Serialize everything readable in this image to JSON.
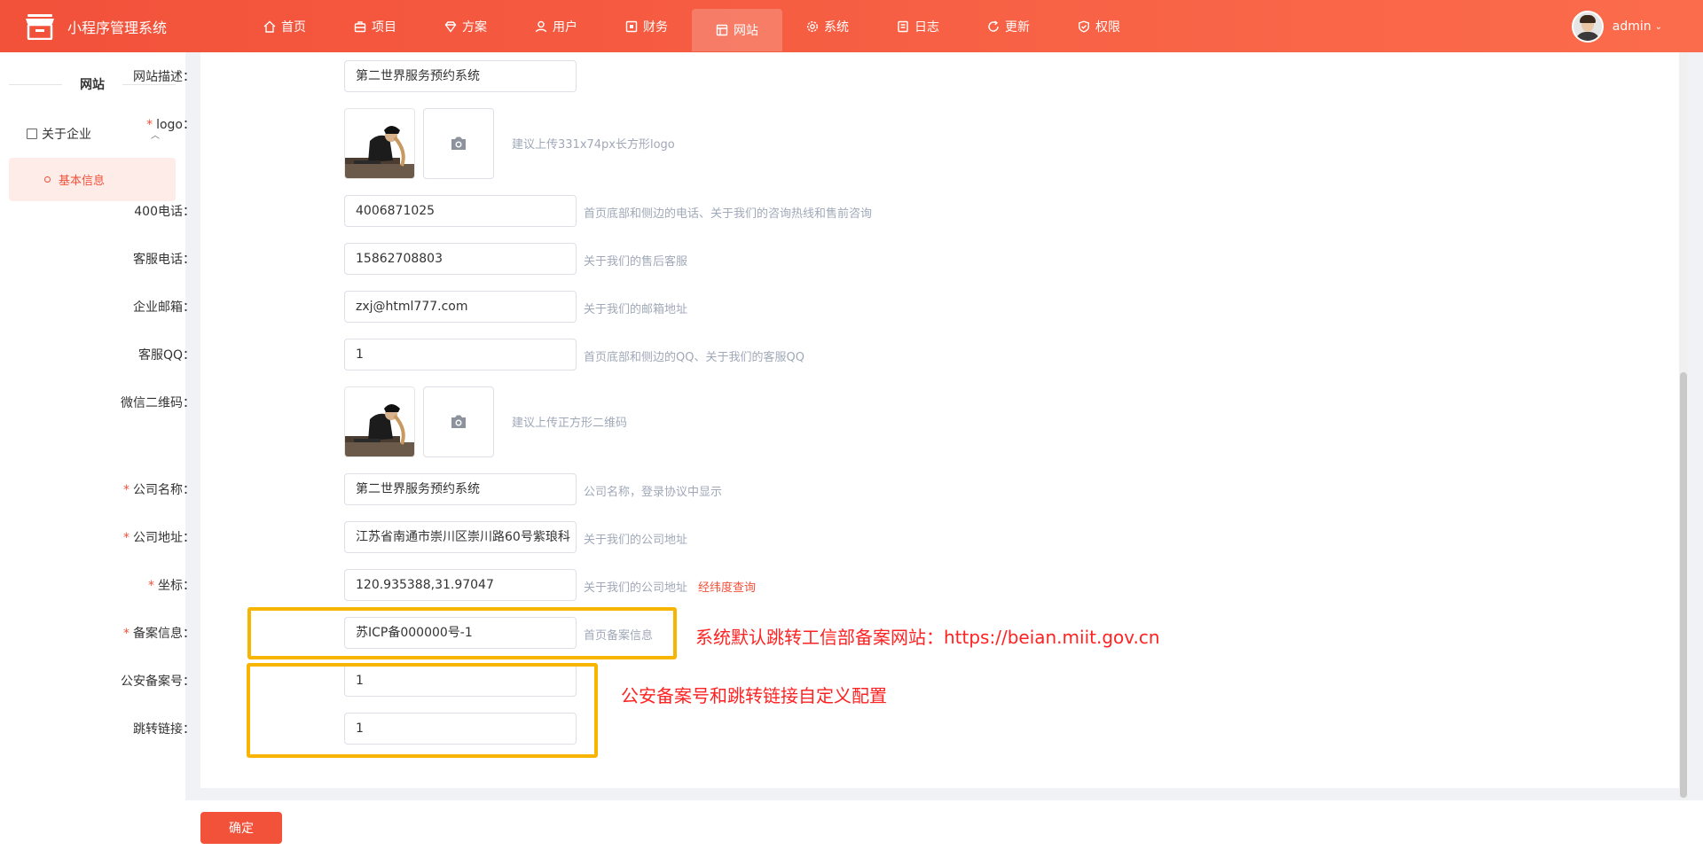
{
  "app": {
    "title": "小程序管理系统"
  },
  "nav": [
    {
      "label": "首页",
      "icon": "home-icon"
    },
    {
      "label": "项目",
      "icon": "briefcase-icon"
    },
    {
      "label": "方案",
      "icon": "diamond-icon"
    },
    {
      "label": "用户",
      "icon": "user-icon"
    },
    {
      "label": "财务",
      "icon": "finance-icon"
    },
    {
      "label": "网站",
      "icon": "website-icon",
      "active": true
    },
    {
      "label": "系统",
      "icon": "gear-icon"
    },
    {
      "label": "日志",
      "icon": "log-icon"
    },
    {
      "label": "更新",
      "icon": "refresh-icon"
    },
    {
      "label": "权限",
      "icon": "shield-icon"
    }
  ],
  "user": {
    "name": "admin",
    "chevron": "⌄"
  },
  "sidebar": {
    "title": "网站",
    "group": {
      "label": "关于企业",
      "arrow": "︿"
    },
    "item": {
      "label": "基本信息"
    }
  },
  "form": {
    "site_desc": {
      "label": "网站描述：",
      "value": "第二世界服务预约系统"
    },
    "logo": {
      "label": "logo：",
      "hint": "建议上传331x74px长方形logo"
    },
    "phone400": {
      "label": "400电话：",
      "value": "4006871025",
      "hint": "首页底部和侧边的电话、关于我们的咨询热线和售前咨询"
    },
    "service_phone": {
      "label": "客服电话：",
      "value": "15862708803",
      "hint": "关于我们的售后客服"
    },
    "email": {
      "label": "企业邮箱：",
      "value": "zxj@html777.com",
      "hint": "关于我们的邮箱地址"
    },
    "qq": {
      "label": "客服QQ：",
      "value": "1",
      "hint": "首页底部和侧边的QQ、关于我们的客服QQ"
    },
    "wechat_qr": {
      "label": "微信二维码：",
      "hint": "建议上传正方形二维码"
    },
    "company_name": {
      "label": "公司名称：",
      "value": "第二世界服务预约系统",
      "hint": "公司名称，登录协议中显示"
    },
    "company_addr": {
      "label": "公司地址：",
      "value": "江苏省南通市崇川区崇川路60号紫琅科",
      "hint": "关于我们的公司地址"
    },
    "coords": {
      "label": "坐标：",
      "value": "120.935388,31.97047",
      "hint": "关于我们的公司地址",
      "link": "经纬度查询"
    },
    "icp": {
      "label": "备案信息：",
      "value": "苏ICP备000000号-1",
      "hint": "首页备案信息"
    },
    "police_no": {
      "label": "公安备案号：",
      "value": "1"
    },
    "jump_link": {
      "label": "跳转链接：",
      "value": "1"
    },
    "required_mark": "*"
  },
  "annotations": {
    "icp_note": "系统默认跳转工信部备案网站：https://beian.miit.gov.cn",
    "police_note": "公安备案号和跳转链接自定义配置"
  },
  "footer": {
    "confirm_label": "确定"
  },
  "colors": {
    "primary": "#f2513a",
    "highlight": "#f7b500",
    "annotation": "#ff2222"
  }
}
